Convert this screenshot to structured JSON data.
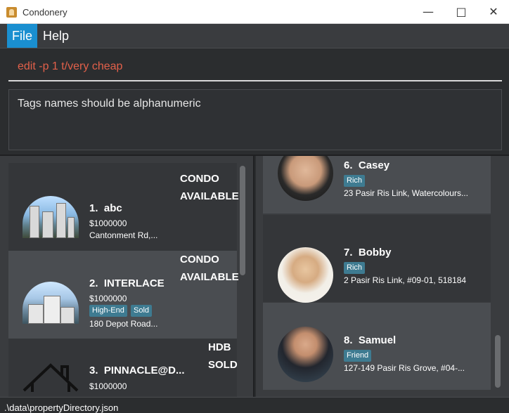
{
  "window": {
    "title": "Condonery"
  },
  "menu": {
    "file": "File",
    "help": "Help"
  },
  "command": {
    "value": "edit -p 1 t/very cheap"
  },
  "result": {
    "message": "Tags names should be alphanumeric"
  },
  "properties": [
    {
      "index": "1.",
      "name": "abc",
      "price": "$1000000",
      "address": "Cantonment Rd,...",
      "type": "CONDO",
      "status": "AVAILABLE",
      "tags": []
    },
    {
      "index": "2.",
      "name": "INTERLACE",
      "price": "$1000000",
      "address": "180 Depot Road...",
      "type": "CONDO",
      "status": "AVAILABLE",
      "tags": [
        "High-End",
        "Sold"
      ]
    },
    {
      "index": "3.",
      "name": "PINNACLE@D...",
      "price": "$1000000",
      "address": "",
      "type": "HDB",
      "status": "SOLD",
      "tags": []
    }
  ],
  "clients": [
    {
      "index": "6.",
      "name": "Casey",
      "tags": [
        "Rich"
      ],
      "address": "23 Pasir Ris Link, Watercolours..."
    },
    {
      "index": "7.",
      "name": "Bobby",
      "tags": [
        "Rich"
      ],
      "address": "2 Pasir Ris Link, #09-01, 518184"
    },
    {
      "index": "8.",
      "name": "Samuel",
      "tags": [
        "Friend"
      ],
      "address": "127-149 Pasir Ris Grove, #04-..."
    }
  ],
  "status": {
    "path": ".\\data\\propertyDirectory.json"
  },
  "icons": {
    "app": "condonery-app-icon",
    "minimize": "minimize-icon",
    "maximize": "maximize-icon",
    "close": "close-icon",
    "house_placeholder": "house-outline-icon"
  },
  "colors": {
    "accent": "#1a8fd0",
    "command_text": "#e2604a",
    "tag_bg": "#3e7b91"
  }
}
